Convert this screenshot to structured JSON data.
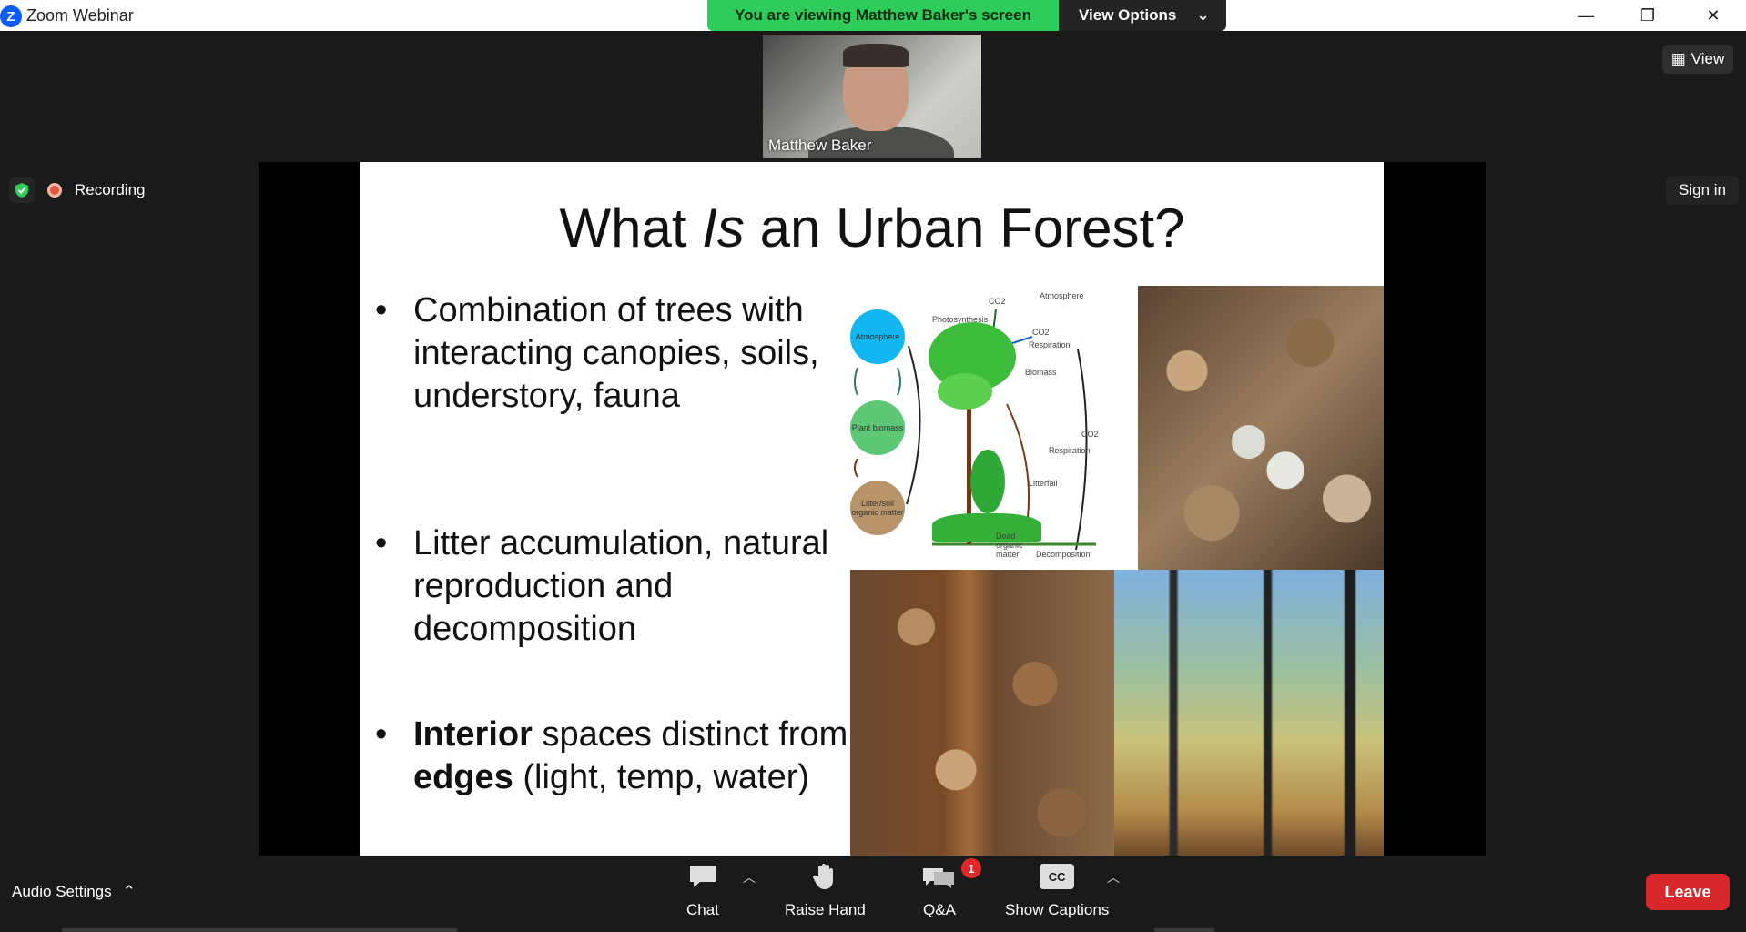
{
  "window": {
    "title": "Zoom Webinar",
    "minimize": "—",
    "restore": "❐",
    "close": "✕"
  },
  "banner": {
    "viewing_text": "You are viewing Matthew Baker's screen",
    "view_options_label": "View Options"
  },
  "video": {
    "participant_name": "Matthew Baker"
  },
  "top_right": {
    "view_label": "View",
    "sign_in_label": "Sign in"
  },
  "status": {
    "recording_label": "Recording"
  },
  "slide": {
    "title_prefix": "What ",
    "title_italic": "Is",
    "title_suffix": " an Urban Forest?",
    "bullet1": "Combination of trees with interacting canopies, soils, understory, fauna",
    "bullet2": "Litter accumulation, natural reproduction and decomposition",
    "bullet3_bold1": "Interior",
    "bullet3_mid": " spaces distinct from ",
    "bullet3_bold2": "edges",
    "bullet3_end": " (light, temp, water)",
    "diagram": {
      "atmosphere_circle": "Atmosphere",
      "plant_circle": "Plant biomass",
      "litter_circle": "Litter/soil organic matter",
      "co2_top": "CO2",
      "atmosphere_label": "Atmosphere",
      "photosynthesis": "Photosynthesis",
      "co2_resp": "CO2",
      "respiration_top": "Respiration",
      "biomass": "Biomass",
      "co2_right": "CO2",
      "respiration_right": "Respiration",
      "litterfall": "Litterfall",
      "dead_om": "Dead organic matter",
      "decomposition": "Decomposition"
    }
  },
  "toolbar": {
    "audio_settings": "Audio Settings",
    "chat": "Chat",
    "raise_hand": "Raise Hand",
    "qa": "Q&A",
    "qa_badge": "1",
    "captions": "Show Captions",
    "cc_icon_text": "CC",
    "leave": "Leave"
  },
  "colors": {
    "banner_green": "#2ecc5b",
    "leave_red": "#d9282c",
    "badge_red": "#e02828"
  }
}
